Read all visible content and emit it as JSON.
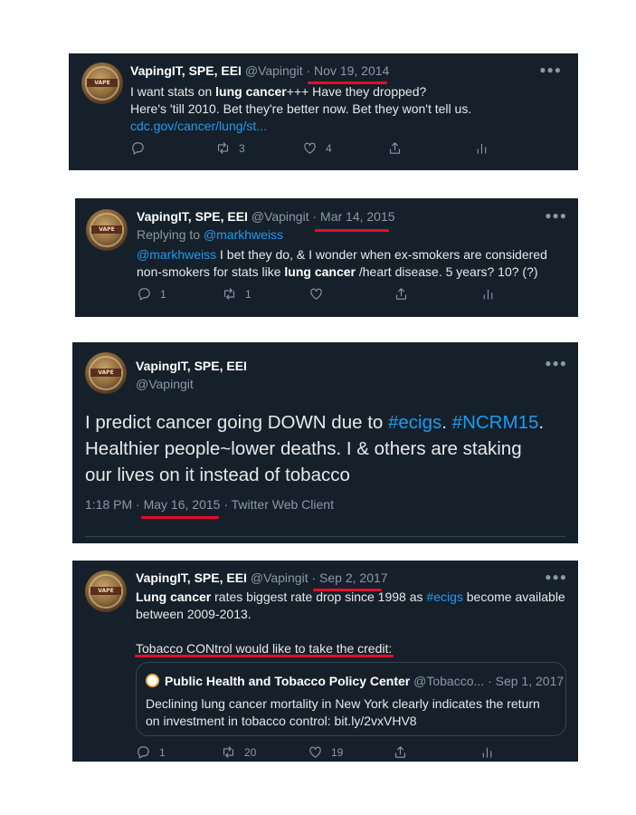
{
  "account": {
    "name": "VapingIT, SPE, EEI",
    "handle": "@Vapingit"
  },
  "tweet1": {
    "date": "Nov 19, 2014",
    "line1_pre": "I want stats on ",
    "line1_bold": "lung cancer",
    "line1_post": "+++ Have they dropped?",
    "line2": "Here's 'till 2010. Bet they're better now. Bet they won't tell us.",
    "link": "cdc.gov/cancer/lung/st...",
    "retweets": "3",
    "likes": "4"
  },
  "tweet2": {
    "date": "Mar 14, 2015",
    "replying_label": "Replying to ",
    "replying_handle": "@markhweiss",
    "mention": "@markhweiss",
    "line1_post": " I bet they do, & I wonder when ex-smokers are considered",
    "line2_pre": "non-smokers for stats like ",
    "line2_bold": "lung cancer",
    "line2_post": " /heart disease. 5 years? 10? (?)",
    "replies": "1",
    "retweets": "1"
  },
  "tweet3": {
    "line1_pre": "I predict cancer going DOWN due to ",
    "hashtag1": "#ecigs",
    "sep": ". ",
    "hashtag2": "#NCRM15",
    "dot": ".",
    "line2": "Healthier people~lower deaths. I & others are staking",
    "line3": "our lives on it instead of tobacco",
    "time": "1:18 PM",
    "date": "May 16, 2015",
    "client": "Twitter Web Client"
  },
  "tweet4": {
    "date": "Sep 2, 2017",
    "line1_bold": "Lung cancer",
    "line1_mid": " rates biggest rate drop since 1998 as ",
    "hashtag": "#ecigs",
    "line1_post": " become available",
    "line2": "between 2009-2013.",
    "line3": "Tobacco CONtrol would like to take the credit:",
    "quote": {
      "name": "Public Health and Tobacco Policy Center",
      "handle": "@Tobacco...",
      "date": "Sep 1, 2017",
      "line1": "Declining lung cancer mortality in New York clearly indicates the return",
      "line2": "on investment in tobacco control: bit.ly/2vxVHV8"
    },
    "replies": "1",
    "retweets": "20",
    "likes": "19"
  },
  "icons": [
    "reply-icon",
    "retweet-icon",
    "like-icon",
    "share-icon",
    "analytics-icon",
    "more-icon"
  ],
  "colors": {
    "background": "#15202b",
    "link": "#1d9bf0",
    "muted": "#8b98a5",
    "underline": "#e0102b"
  }
}
